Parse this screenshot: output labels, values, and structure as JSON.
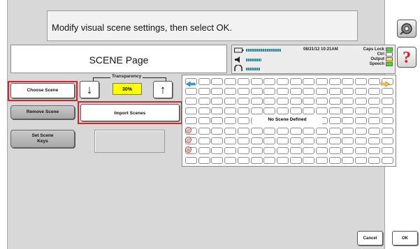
{
  "instruction": "Modify visual scene settings, then select OK.",
  "page_title": "SCENE Page",
  "status": {
    "datetime": "08/21/12 10:21AM",
    "indicators": [
      "Caps Lock",
      "Ctrl",
      "Output",
      "Speech"
    ],
    "indicator_colors": [
      "#44dd22",
      "#ffffff",
      "#f2e24a",
      "#44dd22"
    ]
  },
  "help_label": "?",
  "buttons": {
    "choose_scene": "Choose Scene",
    "remove_scene": "Remove Scene",
    "set_scene_keys_line1": "Set Scene",
    "set_scene_keys_line2": "Keys",
    "import_scenes": "Import Scenes",
    "cancel": "Cancel",
    "ok": "OK"
  },
  "transparency": {
    "label": "Transparency",
    "value": "30%",
    "down_arrow": "↓",
    "up_arrow": "↑"
  },
  "grid": {
    "empty_message": "No Scene Defined"
  },
  "colors": {
    "highlight": "#d8232a",
    "transparency_value_bg": "#ffff00",
    "help_red": "#d81f2a"
  }
}
